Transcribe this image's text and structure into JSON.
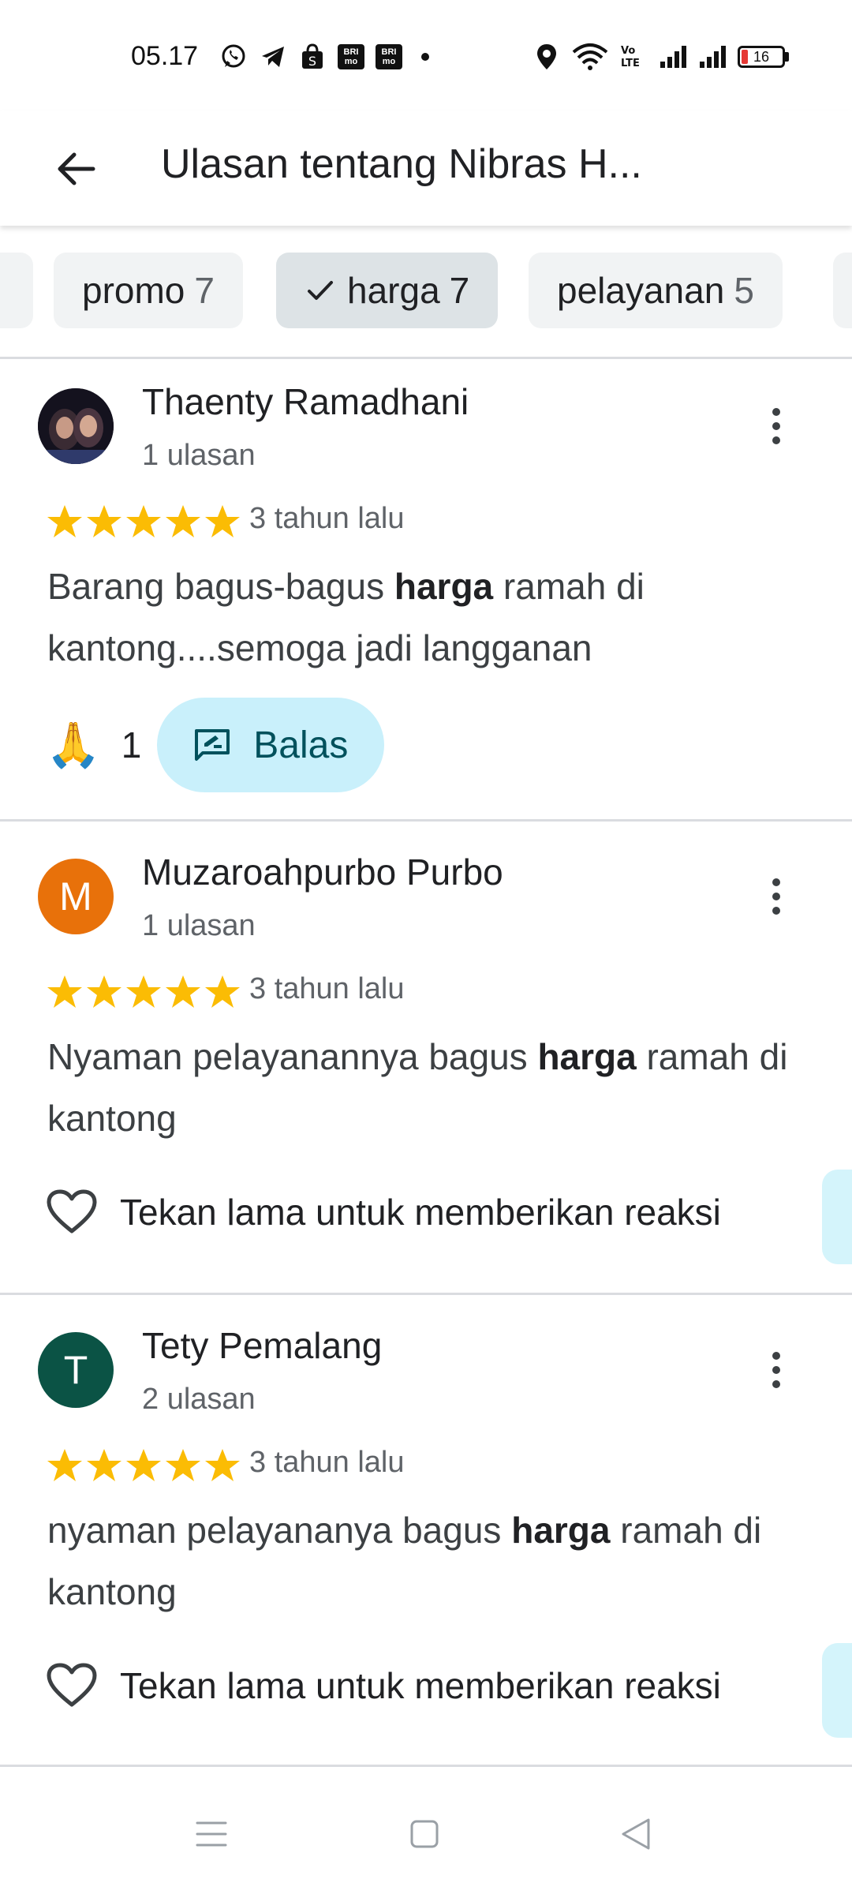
{
  "status_bar": {
    "time": "05.17",
    "battery": "16",
    "battery_level": 0.16,
    "left_icons": [
      "whatsapp-icon",
      "telegram-icon",
      "shopping-bag-icon",
      "brimo-icon",
      "brimo-icon",
      "dot-icon"
    ],
    "right_icons": [
      "location-icon",
      "wifi-icon",
      "volte-icon",
      "signal-icon",
      "signal-icon",
      "battery-icon"
    ],
    "bri_label": "BRI mo"
  },
  "app_bar": {
    "title": "Ulasan tentang Nibras H..."
  },
  "chips": [
    {
      "label": "promo",
      "count": "7",
      "selected": false
    },
    {
      "label": "harga",
      "count": "7",
      "selected": true
    },
    {
      "label": "pelayanan",
      "count": "5",
      "selected": false
    }
  ],
  "reviews": [
    {
      "name": "Thaenty Ramadhani",
      "review_count": "1 ulasan",
      "rating": 5,
      "time": "3 tahun lalu",
      "text_before": "Barang bagus-bagus ",
      "highlight": "harga",
      "text_after": " ramah di kantong....semoga jadi langganan",
      "reaction_emoji": "🙏",
      "reaction_count": "1",
      "reply_label": "Balas"
    },
    {
      "name": "Muzaroahpurbo Purbo",
      "avatar_letter": "M",
      "avatar_color": "#e8710a",
      "review_count": "1 ulasan",
      "rating": 5,
      "time": "3 tahun lalu",
      "text_before": "Nyaman pelayanannya bagus ",
      "highlight": "harga",
      "text_after": " ramah di kantong",
      "reaction_hint": "Tekan lama untuk memberikan reaksi"
    },
    {
      "name": "Tety Pemalang",
      "avatar_letter": "T",
      "avatar_color": "#0b5345",
      "review_count": "2 ulasan",
      "rating": 5,
      "time": "3 tahun lalu",
      "text_before": "nyaman pelayananya bagus ",
      "highlight": "harga",
      "text_after": " ramah di kantong",
      "reaction_hint": "Tekan lama untuk memberikan reaksi"
    }
  ],
  "colors": {
    "star": "#fbbc04",
    "chip_bg": "#f1f3f4",
    "chip_selected_bg": "#dde3e6",
    "reply_bg": "#c9f0fb",
    "reply_text": "#00515c"
  },
  "nav_bar": {
    "buttons": [
      "menu-icon",
      "home-icon",
      "back-triangle-icon"
    ]
  }
}
